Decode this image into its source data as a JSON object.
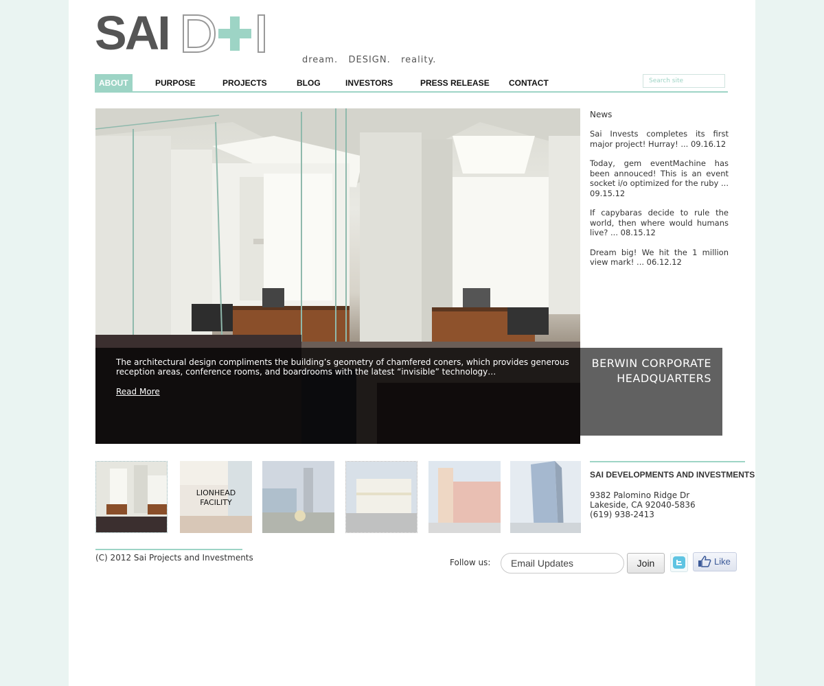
{
  "brand": {
    "logo_sai": "SAI",
    "logo_d": "D",
    "logo_plus": "+",
    "logo_i": "I",
    "tagline": "dream.   DESIGN.   reality.",
    "accent_color": "#9dd4c5",
    "dark_color": "#555555"
  },
  "nav": {
    "items": [
      {
        "label": "ABOUT",
        "active": true
      },
      {
        "label": "PURPOSE"
      },
      {
        "label": "PROJECTS"
      },
      {
        "label": "BLOG"
      },
      {
        "label": "INVESTORS"
      },
      {
        "label": "PRESS RELEASE"
      },
      {
        "label": "CONTACT"
      }
    ],
    "search_placeholder": "Search site"
  },
  "hero": {
    "caption": "The architectural design compliments the building’s geometry of chamfered coners, which provides generous reception areas, conference rooms, and boardrooms with the latest “invisible” technology…",
    "read_more": "Read More",
    "project_title": "BERWIN CORPORATE HEADQUARTERS"
  },
  "news": {
    "heading": "News",
    "items": [
      "Sai Invests completes its first major project!  Hurray!  ...  09.16.12",
      "Today, gem eventMachine has been annouced!  This is an event socket i/o optimized for the ruby ... 09.15.12",
      "If capybaras decide to rule the world, then where would humans live?  ... 08.15.12",
      "Dream big!  We hit the 1 million view mark!  ... 06.12.12"
    ]
  },
  "thumbnails": [
    {
      "label": "",
      "icon": "office-interior-image"
    },
    {
      "label": "LIONHEAD FACILITY",
      "icon": "atrium-image"
    },
    {
      "label": "",
      "icon": "plaza-image"
    },
    {
      "label": "",
      "icon": "street-building-image"
    },
    {
      "label": "",
      "icon": "tower-image"
    },
    {
      "label": "",
      "icon": "glass-tower-image"
    }
  ],
  "company": {
    "name": "SAI DEVELOPMENTS AND INVESTMENTS",
    "address_line1": "9382 Palomino Ridge Dr",
    "address_line2": "Lakeside, CA 92040-5836",
    "phone": "(619) 938-2413"
  },
  "footer": {
    "copyright": "(C) 2012 Sai Projects and Investments",
    "follow_label": "Follow us:",
    "email_placeholder": "Email Updates",
    "join_label": "Join",
    "like_label": "Like"
  }
}
